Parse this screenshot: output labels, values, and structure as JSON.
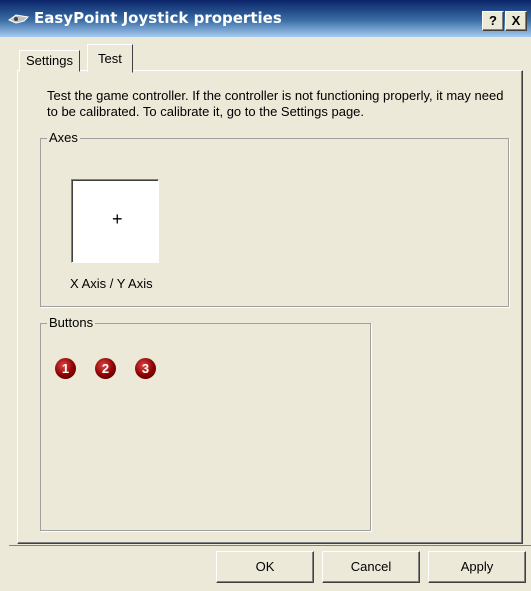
{
  "window": {
    "title": "EasyPoint Joystick properties",
    "help_label": "?",
    "close_label": "X",
    "titlebar_color": "#0a246a"
  },
  "tabs": [
    {
      "label": "Settings",
      "active": false
    },
    {
      "label": "Test",
      "active": true
    }
  ],
  "test_page": {
    "description": "Test the game controller.  If the controller is not functioning properly, it may need to be calibrated.  To calibrate it, go to the Settings page.",
    "axes": {
      "group_label": "Axes",
      "cursor_symbol": "+",
      "axis_label": "X Axis / Y Axis"
    },
    "buttons": {
      "group_label": "Buttons",
      "items": [
        "1",
        "2",
        "3"
      ],
      "indicator_color": "#8b0000"
    }
  },
  "dialog_buttons": {
    "ok": "OK",
    "cancel": "Cancel",
    "apply": "Apply"
  }
}
